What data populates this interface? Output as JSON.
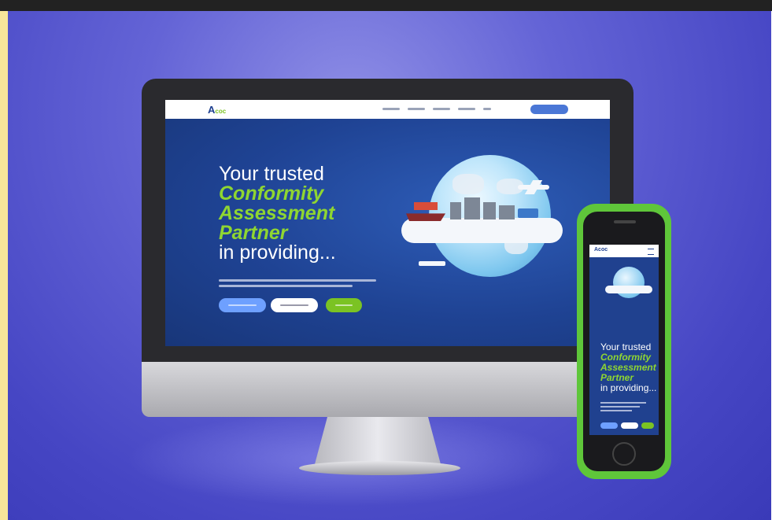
{
  "site": {
    "logo_mark": "A",
    "logo_rest": "coc",
    "hero": {
      "line1": "Your trusted",
      "line2": "Conformity",
      "line3": "Assessment",
      "line4": "Partner",
      "line5": "in providing..."
    }
  },
  "mobile": {
    "logo": "Acoc",
    "hero": {
      "line1": "Your trusted",
      "line2": "Conformity",
      "line3": "Assessment",
      "line4": "Partner",
      "line5": "in providing..."
    }
  },
  "colors": {
    "background": "#5a5ad0",
    "site_blue": "#20418f",
    "accent_green": "#8fd631",
    "button_blue": "#6ea0ff",
    "phone_body": "#5fc63a"
  },
  "icons": {
    "menu": "hamburger-icon"
  }
}
